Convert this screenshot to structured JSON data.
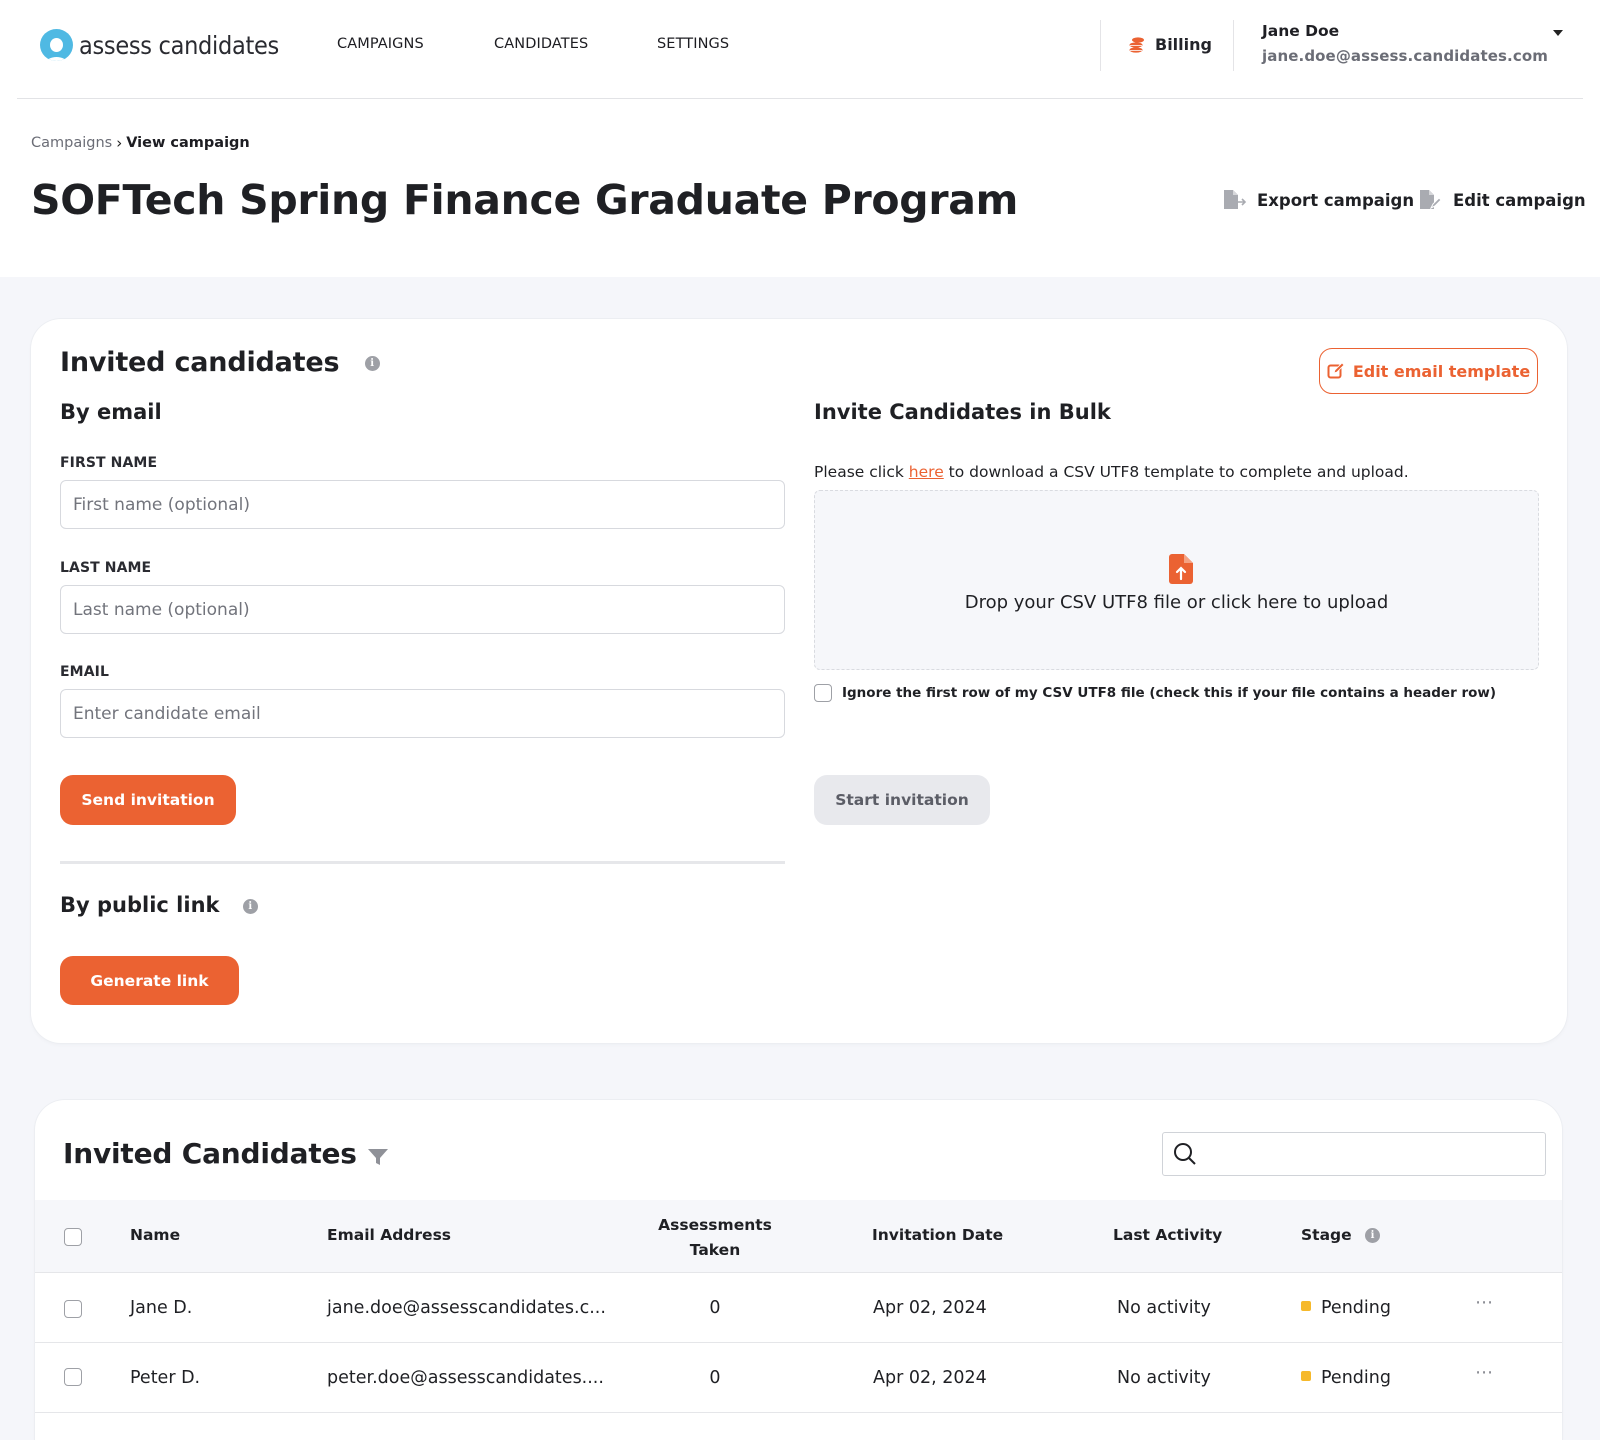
{
  "brand": {
    "name": "assess candidates",
    "color": "#4fb9e3"
  },
  "colors": {
    "accent": "#eb6232",
    "pending": "#f6b92b"
  },
  "nav": {
    "links": [
      {
        "label": "CAMPAIGNS"
      },
      {
        "label": "CANDIDATES"
      },
      {
        "label": "SETTINGS"
      }
    ],
    "billing_label": "Billing",
    "user": {
      "name": "Jane Doe",
      "email": "jane.doe@assess.candidates.com"
    }
  },
  "breadcrumb": {
    "parent": "Campaigns",
    "current": "View campaign"
  },
  "page": {
    "title": "SOFTech Spring Finance Graduate Program",
    "export_label": "Export campaign",
    "edit_label": "Edit campaign"
  },
  "invite_card": {
    "title": "Invited candidates",
    "edit_template_label": "Edit email template",
    "by_email": {
      "title": "By email",
      "first_name": {
        "label": "FIRST NAME",
        "placeholder": "First name (optional)",
        "value": ""
      },
      "last_name": {
        "label": "LAST NAME",
        "placeholder": "Last name (optional)",
        "value": ""
      },
      "email": {
        "label": "EMAIL",
        "placeholder": "Enter candidate email",
        "value": ""
      },
      "send_label": "Send invitation"
    },
    "by_link": {
      "title": "By public link",
      "generate_label": "Generate link"
    },
    "bulk": {
      "title": "Invite Candidates in Bulk",
      "text_before": "Please click ",
      "link_text": "here",
      "text_after": " to download a CSV UTF8 template to complete and upload.",
      "dropzone_text": "Drop your CSV UTF8 file or click here to upload",
      "ignore_label": "Ignore the first row of my CSV UTF8 file (check this if your file contains a header row)",
      "ignore_checked": false,
      "start_label": "Start invitation"
    }
  },
  "table": {
    "title": "Invited Candidates",
    "search": {
      "placeholder": "",
      "value": ""
    },
    "columns": {
      "name": "Name",
      "email": "Email Address",
      "assessments_l1": "Assessments",
      "assessments_l2": "Taken",
      "invited": "Invitation Date",
      "activity": "Last Activity",
      "stage": "Stage"
    },
    "rows": [
      {
        "name": "Jane D.",
        "email": "jane.doe@assesscandidates.c...",
        "assessments": "0",
        "invited": "Apr 02, 2024",
        "activity": "No activity",
        "stage": "Pending"
      },
      {
        "name": "Peter D.",
        "email": "peter.doe@assesscandidates....",
        "assessments": "0",
        "invited": "Apr 02, 2024",
        "activity": "No activity",
        "stage": "Pending"
      }
    ]
  }
}
